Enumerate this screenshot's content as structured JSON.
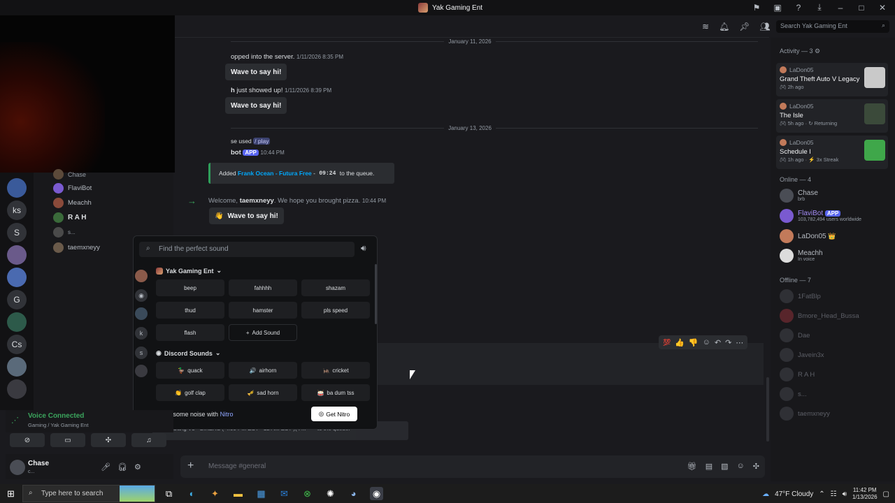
{
  "window": {
    "title": "Yak Gaming Ent"
  },
  "header": {
    "search_placeholder": "Search Yak Gaming Ent"
  },
  "chat": {
    "dates": [
      "January 11, 2026",
      "January 13, 2026"
    ],
    "msg1": {
      "text": "opped into the server.",
      "time": "1/11/2026 8:35 PM",
      "wave": "Wave to say hi!"
    },
    "msg2": {
      "user": "h",
      "text": "just showed up!",
      "time": "1/11/2026 8:39 PM",
      "wave": "Wave to say hi!"
    },
    "msg3": {
      "prefix": "se used",
      "command": "/ play",
      "bot": "bot",
      "app": "APP",
      "time": "10:44 PM",
      "embed_pre": "Added",
      "embed_song": "Frank Ocean - Futura Free",
      "embed_dash": "-",
      "embed_dur": "09:24",
      "embed_post": "to the queue."
    },
    "msg4": {
      "welcome": "Welcome,",
      "user": "taemxneyy",
      "rest": ". We hope you brought pizza.",
      "time": "10:44 PM",
      "wave": "Wave to say hi!"
    },
    "under_text": "Chain Gang V3 - BIKERS ( 4:00 PM EST - 12 AM EST )( F...",
    "under_tail": "to the queue.",
    "composer_placeholder": "Message #general"
  },
  "voice_users": [
    {
      "name": "Chase"
    },
    {
      "name": "FlaviBot"
    },
    {
      "name": "Meachh"
    },
    {
      "name": "R A H"
    },
    {
      "name": "s..."
    },
    {
      "name": "taemxneyy"
    }
  ],
  "guilds": [
    "ks",
    "S",
    "G",
    "Cs"
  ],
  "soundboard": {
    "search_placeholder": "Find the perfect sound",
    "group1": "Yak Gaming Ent",
    "group1_sounds": [
      "beep",
      "fahhhh",
      "shazam",
      "thud",
      "hamster",
      "pls speed",
      "flash"
    ],
    "add_sound": "Add Sound",
    "group2": "Discord Sounds",
    "group2_sounds": [
      {
        "emoji": "🦆",
        "label": "quack"
      },
      {
        "emoji": "🔊",
        "label": "airhorn"
      },
      {
        "emoji": "🦗",
        "label": "cricket"
      },
      {
        "emoji": "👏",
        "label": "golf clap"
      },
      {
        "emoji": "🎺",
        "label": "sad horn"
      },
      {
        "emoji": "🥁",
        "label": "ba dum tss"
      }
    ],
    "nitro_text": "Make some noise with",
    "nitro_word": "Nitro",
    "nitro_btn": "Get Nitro"
  },
  "voice": {
    "status": "Voice Connected",
    "channel": "Gaming / Yak Gaming Ent"
  },
  "user": {
    "name": "Chase",
    "status": "c..."
  },
  "members": {
    "activity_header": "Activity — 3",
    "activities": [
      {
        "user": "LaDon05",
        "game": "Grand Theft Auto V Legacy",
        "time": "2h ago",
        "extra": "",
        "art": "#c9c9c9"
      },
      {
        "user": "LaDon05",
        "game": "The Isle",
        "time": "5h ago",
        "extra": "Returning",
        "art": "#3b4a3a"
      },
      {
        "user": "LaDon05",
        "game": "Schedule I",
        "time": "1h ago",
        "extra": "3x Streak",
        "art": "#3fa74a"
      }
    ],
    "online_header": "Online — 4",
    "online": [
      {
        "name": "Chase",
        "sub": "brb",
        "badge": ""
      },
      {
        "name": "FlaviBot",
        "sub": "103,782,494 users worldwide",
        "badge": "APP"
      },
      {
        "name": "LaDon05",
        "sub": "",
        "badge": "👑"
      },
      {
        "name": "Meachh",
        "sub": "In voice",
        "badge": ""
      }
    ],
    "offline_header": "Offline — 7",
    "offline": [
      "1FatBlp",
      "Bmore_Head_Bussa",
      "Dae",
      "Javein3x",
      "R A H",
      "s...",
      "taemxneyy"
    ]
  },
  "taskbar": {
    "search": "Type here to search",
    "weather": "47°F  Cloudy",
    "time": "11:42 PM",
    "date": "1/13/2026"
  }
}
